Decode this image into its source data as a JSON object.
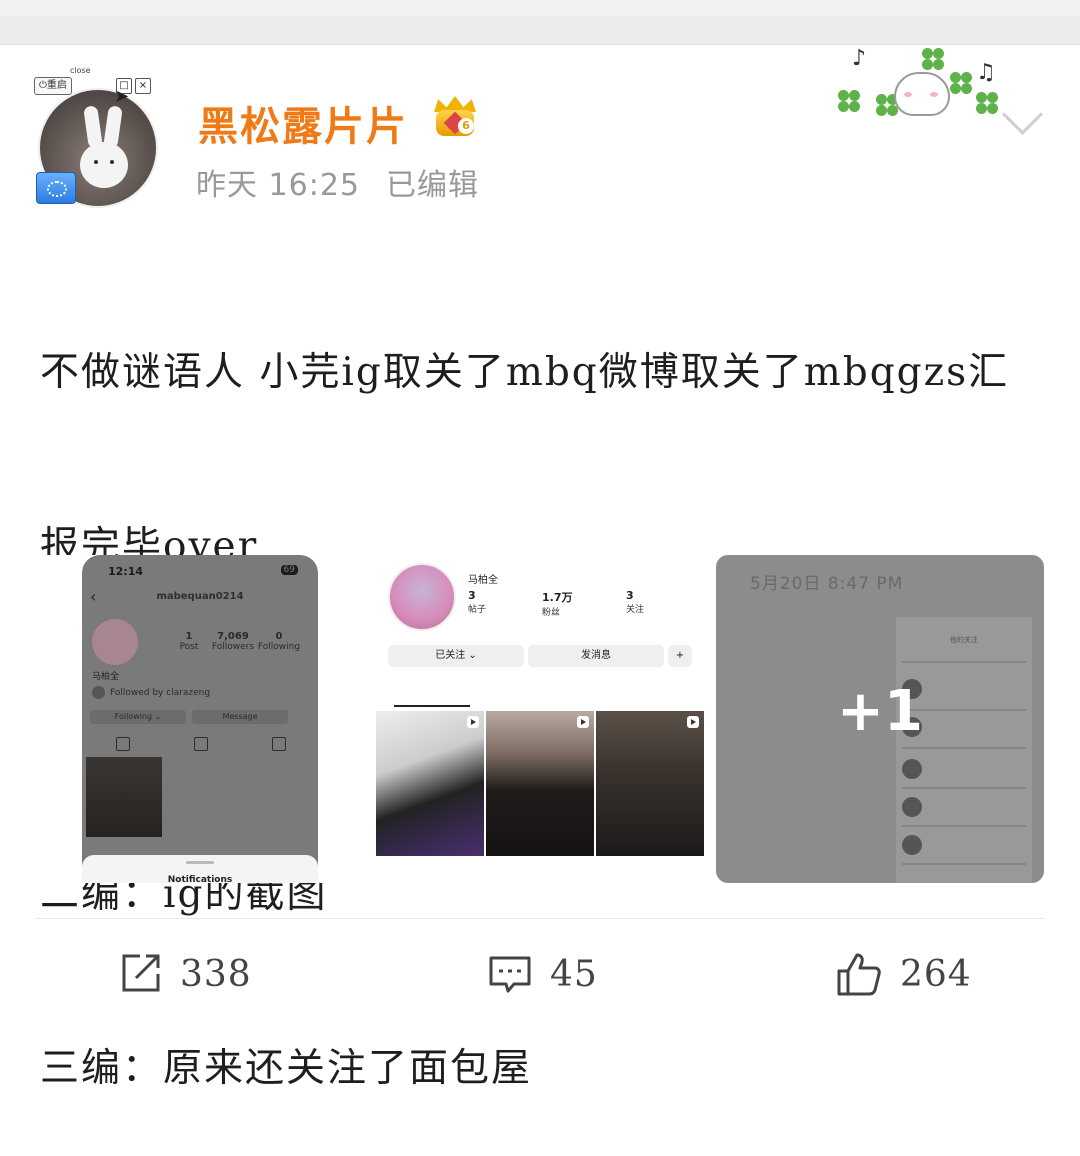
{
  "post": {
    "username": "黑松露片片",
    "vip_level": "6",
    "time": "昨天 16:25",
    "edited": "已编辑",
    "avatar_overlay": {
      "restart": "⏻重启",
      "close": "close"
    },
    "text_line1": "不做谜语人 小芫ig取关了mbq微博取关了mbqgzs汇",
    "text_line2": "报完毕over",
    "edit2": "二编：ig的截图",
    "edit3": "三编：原来还关注了面包屋"
  },
  "images": {
    "ig_screen": {
      "time": "12:14",
      "battery": "69",
      "username": "mabequan0214",
      "posts": "1",
      "posts_label": "Post",
      "followers": "7,069",
      "followers_label": "Followers",
      "following": "0",
      "following_label": "Following",
      "name": "马柏全",
      "followed_by": "Followed by clarazeng",
      "btn_following": "Following ⌄",
      "btn_message": "Message",
      "sheet_title": "Notifications"
    },
    "profile_screen": {
      "name": "马柏全",
      "posts": "3",
      "posts_label": "帖子",
      "fans": "1.7万",
      "fans_label": "粉丝",
      "following": "3",
      "following_label": "关注",
      "btn_followed": "已关注 ⌄",
      "btn_message": "发消息"
    },
    "third": {
      "date": "5月20日 8:47 PM",
      "screen_title": "他的关注",
      "more_count": "+1"
    }
  },
  "actions": {
    "repost_count": "338",
    "comment_count": "45",
    "like_count": "264"
  }
}
